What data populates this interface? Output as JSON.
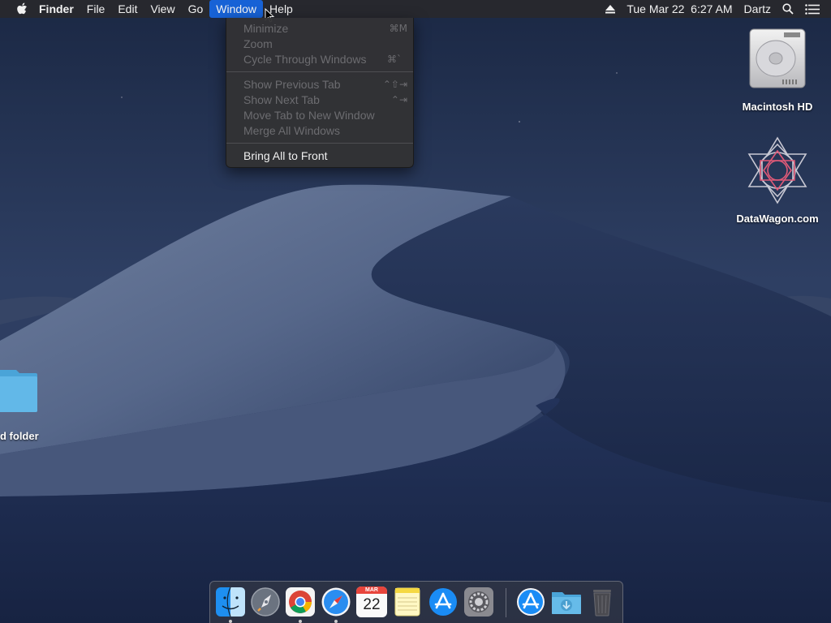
{
  "menubar": {
    "app_name": "Finder",
    "menus": [
      "File",
      "Edit",
      "View",
      "Go",
      "Window",
      "Help"
    ],
    "active_menu": "Window",
    "clock": "Tue Mar 22  6:27 AM",
    "user": "Dartz"
  },
  "window_menu": {
    "minimize": {
      "label": "Minimize",
      "shortcut": "⌘M"
    },
    "zoom": {
      "label": "Zoom"
    },
    "cycle": {
      "label": "Cycle Through Windows",
      "shortcut": "⌘`"
    },
    "prev_tab": {
      "label": "Show Previous Tab",
      "shortcut": "⌃⇧⇥"
    },
    "next_tab": {
      "label": "Show Next Tab",
      "shortcut": "⌃⇥"
    },
    "move_tab": {
      "label": "Move Tab to New Window"
    },
    "merge": {
      "label": "Merge All Windows"
    },
    "bring_front": {
      "label": "Bring All to Front"
    }
  },
  "desktop": {
    "hd_label": "Macintosh HD",
    "datawagon_label": "DataWagon.com",
    "folder_label": "d folder"
  },
  "dock": {
    "apps": [
      "finder",
      "launchpad",
      "chrome",
      "safari",
      "calendar",
      "notes",
      "app-store",
      "system-preferences",
      "app-store-downloads",
      "downloads-folder",
      "trash"
    ],
    "calendar_month": "MAR",
    "calendar_day": "22"
  },
  "colors": {
    "menu_highlight": "#1762d6",
    "menubar_bg": "#28282c",
    "menu_bg": "#323234",
    "disabled_text": "#6c6c70"
  }
}
